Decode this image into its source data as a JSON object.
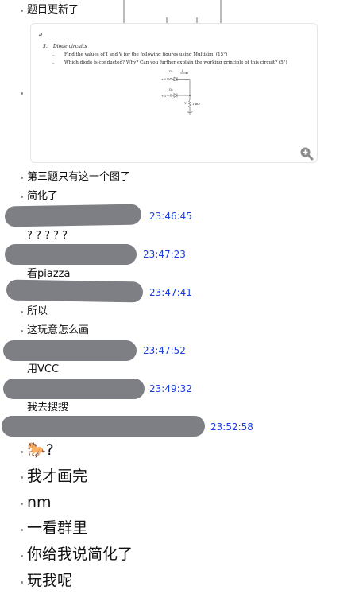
{
  "messages_top": [
    {
      "text": "题目更新了"
    },
    {
      "text": "第三题只有这一个图了"
    },
    {
      "text": "简化了"
    }
  ],
  "image_card": {
    "return_mark": "↵",
    "problem_number": "3.",
    "problem_title": "Diode circuits",
    "line1": "Find the values of I and V for the following figures using Multisim. (15°)",
    "line2": "Which diode is conducted? Why? Can you further explain the working principle of this circuit? (5°)",
    "d1": "D₁",
    "d2": "D₂",
    "i_label": "I",
    "v1": "+6 V",
    "v2": "+3 V",
    "v_label": "V",
    "r_label": "1 kΩ",
    "zoom_icon": "zoom-in-icon"
  },
  "timestamps": {
    "t1": "23:46:45",
    "t2": "23:47:23",
    "t3": "23:47:41",
    "t4": "23:47:52",
    "t5": "23:49:32",
    "t6": "23:52:58"
  },
  "texts": {
    "q": "? ? ? ? ?",
    "piazza": "看piazza",
    "suoyi": "所以",
    "zenme": "这玩意怎么画",
    "vcc": "用VCC",
    "sousou": "我去搜搜"
  },
  "big_messages": [
    {
      "text": "🐎?"
    },
    {
      "text": "我才画完"
    },
    {
      "text": "nm"
    },
    {
      "text": "一看群里"
    },
    {
      "text": "你给我说简化了"
    },
    {
      "text": "玩我呢"
    }
  ],
  "colors": {
    "timestamp": "#1a3fe0",
    "redaction": "#7d7f84"
  }
}
